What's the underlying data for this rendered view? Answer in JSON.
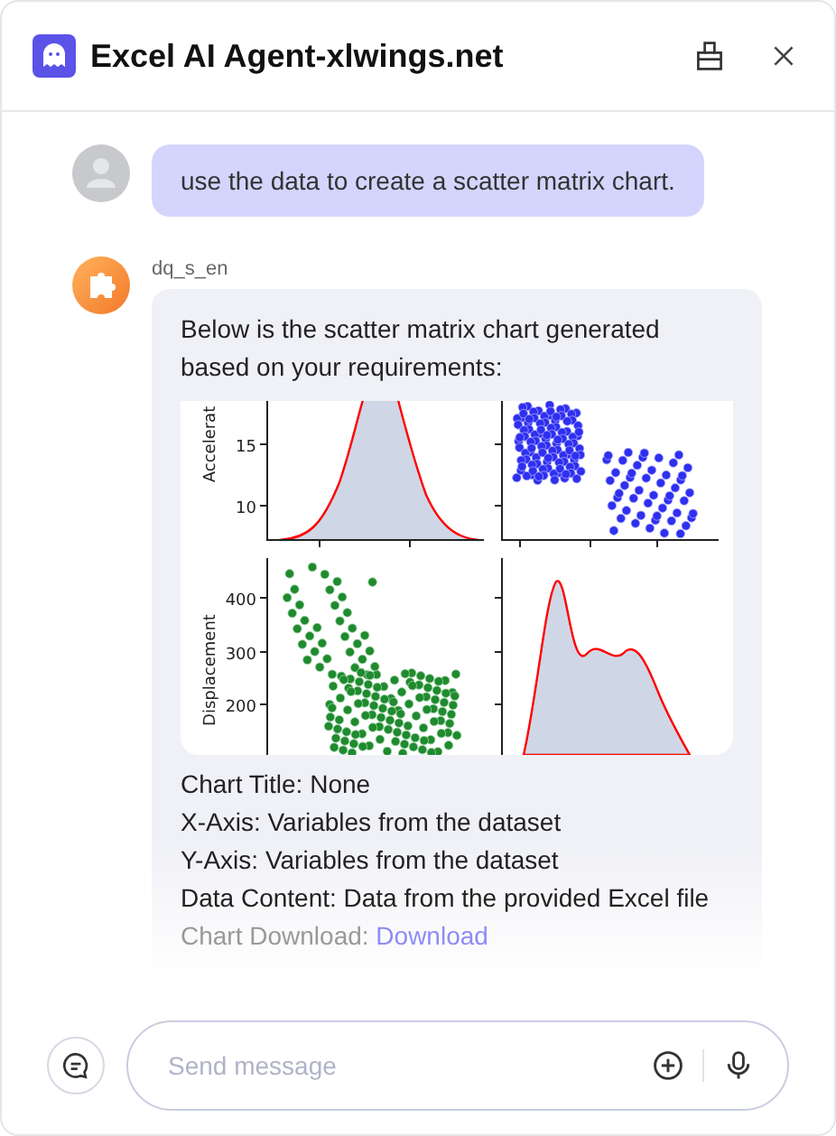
{
  "header": {
    "title": "Excel AI Agent-xlwings.net"
  },
  "messages": [
    {
      "kind": "user",
      "text": "use the data to create a scatter matrix chart."
    },
    {
      "kind": "bot",
      "name": "dq_s_en",
      "intro": "Below is the scatter matrix chart generated based on your requirements:",
      "chart": {
        "y_labels": [
          "Accelerat",
          "Displacement"
        ],
        "top_yticks": [
          "15",
          "10"
        ],
        "bottom_yticks": [
          "400",
          "300",
          "200"
        ]
      },
      "details": [
        "Chart Title: None",
        "X-Axis: Variables from the dataset",
        "Y-Axis: Variables from the dataset",
        "Data Content: Data from the provided Excel file"
      ],
      "download": {
        "label": "Chart Download: ",
        "link": "Download"
      }
    }
  ],
  "composer": {
    "placeholder": "Send message"
  }
}
